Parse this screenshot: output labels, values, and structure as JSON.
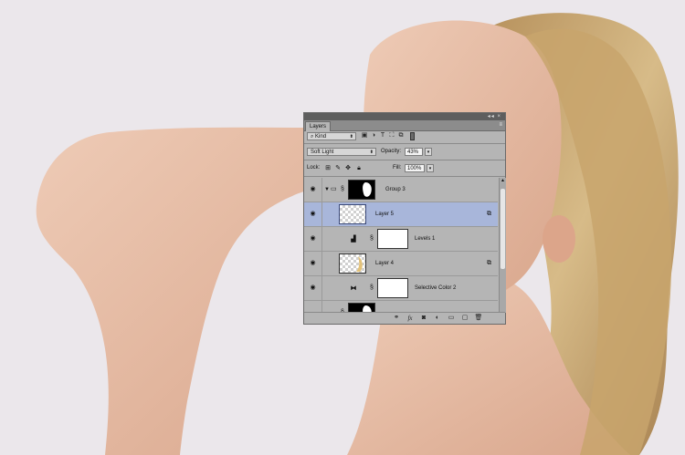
{
  "panel": {
    "tab_label": "Layers",
    "window_buttons": "◂◂ ×",
    "menu_glyph": "≡",
    "filter": {
      "kind_label": "Kind",
      "icons": [
        "image-filter-icon",
        "adjustment-filter-icon",
        "type-filter-icon",
        "shape-filter-icon",
        "smart-object-filter-icon"
      ]
    },
    "blend_mode": "Soft Light",
    "opacity_label": "Opacity:",
    "opacity_value": "43%",
    "lock_label": "Lock:",
    "fill_label": "Fill:",
    "fill_value": "100%"
  },
  "layers": [
    {
      "name": "Group 3",
      "type": "group",
      "selected": false
    },
    {
      "name": "Layer 5",
      "type": "pixel",
      "selected": true
    },
    {
      "name": "Levels 1",
      "type": "adjustment",
      "selected": false
    },
    {
      "name": "Layer 4",
      "type": "pixel",
      "selected": false
    },
    {
      "name": "Selective Color 2",
      "type": "adjustment",
      "selected": false
    }
  ],
  "colors": {
    "background": "#ebe7eb",
    "selected_layer": "#a8b6da",
    "panel": "#b5b5b5",
    "skin": "#e9bfa6",
    "hair": "#c9a772"
  }
}
